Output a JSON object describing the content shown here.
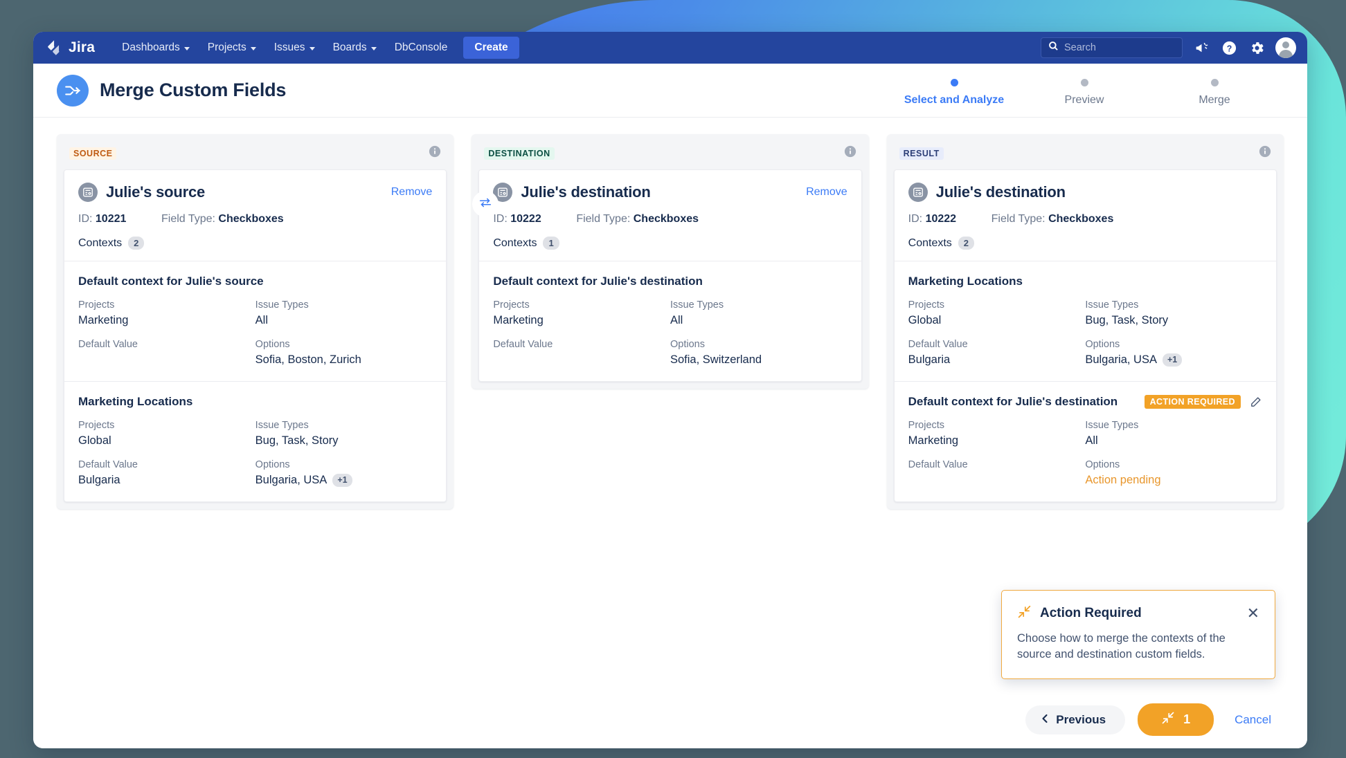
{
  "topnav": {
    "brand": "Jira",
    "items": [
      {
        "label": "Dashboards",
        "has_caret": true
      },
      {
        "label": "Projects",
        "has_caret": true
      },
      {
        "label": "Issues",
        "has_caret": true
      },
      {
        "label": "Boards",
        "has_caret": true
      },
      {
        "label": "DbConsole",
        "has_caret": false
      }
    ],
    "create_label": "Create",
    "search": {
      "value": "",
      "placeholder": "Search"
    },
    "icons": [
      "megaphone-icon",
      "help-icon",
      "settings-icon",
      "avatar"
    ],
    "bg_color": "#24459e",
    "create_color": "#3b63d8"
  },
  "header": {
    "title": "Merge Custom Fields",
    "icon": "merge-arrows-icon",
    "icon_color": "#4a90f0",
    "steps": [
      {
        "label": "Select and Analyze",
        "active": true
      },
      {
        "label": "Preview",
        "active": false
      },
      {
        "label": "Merge",
        "active": false
      }
    ],
    "active_color": "#3b7bf6",
    "inactive_color": "#6b778c"
  },
  "panels": {
    "source": {
      "tag": "SOURCE",
      "field_name": "Julie's source",
      "remove_label": "Remove",
      "id_label": "ID:",
      "id_value": "10221",
      "field_type_label": "Field Type:",
      "field_type_value": "Checkboxes",
      "contexts_label": "Contexts",
      "contexts_count": "2",
      "contexts": [
        {
          "title": "Default context for Julie's source",
          "projects_label": "Projects",
          "projects_value": "Marketing",
          "issue_types_label": "Issue Types",
          "issue_types_value": "All",
          "default_value_label": "Default Value",
          "default_value": "",
          "options_label": "Options",
          "options_value": "Sofia, Boston, Zurich",
          "options_extra": ""
        },
        {
          "title": "Marketing Locations",
          "projects_label": "Projects",
          "projects_value": "Global",
          "issue_types_label": "Issue Types",
          "issue_types_value": "Bug, Task, Story",
          "default_value_label": "Default Value",
          "default_value": "Bulgaria",
          "options_label": "Options",
          "options_value": "Bulgaria, USA",
          "options_extra": "+1"
        }
      ]
    },
    "destination": {
      "tag": "DESTINATION",
      "field_name": "Julie's destination",
      "remove_label": "Remove",
      "id_label": "ID:",
      "id_value": "10222",
      "field_type_label": "Field Type:",
      "field_type_value": "Checkboxes",
      "contexts_label": "Contexts",
      "contexts_count": "1",
      "contexts": [
        {
          "title": "Default context for Julie's destination",
          "projects_label": "Projects",
          "projects_value": "Marketing",
          "issue_types_label": "Issue Types",
          "issue_types_value": "All",
          "default_value_label": "Default Value",
          "default_value": "",
          "options_label": "Options",
          "options_value": "Sofia, Switzerland",
          "options_extra": ""
        }
      ]
    },
    "result": {
      "tag": "RESULT",
      "field_name": "Julie's destination",
      "id_label": "ID:",
      "id_value": "10222",
      "field_type_label": "Field Type:",
      "field_type_value": "Checkboxes",
      "contexts_label": "Contexts",
      "contexts_count": "2",
      "contexts": [
        {
          "title": "Marketing Locations",
          "badge": "",
          "projects_label": "Projects",
          "projects_value": "Global",
          "issue_types_label": "Issue Types",
          "issue_types_value": "Bug, Task, Story",
          "default_value_label": "Default Value",
          "default_value": "Bulgaria",
          "options_label": "Options",
          "options_value": "Bulgaria, USA",
          "options_extra": "+1",
          "options_pending": false
        },
        {
          "title": "Default context for Julie's destination",
          "badge": "ACTION REQUIRED",
          "projects_label": "Projects",
          "projects_value": "Marketing",
          "issue_types_label": "Issue Types",
          "issue_types_value": "All",
          "default_value_label": "Default Value",
          "default_value": "",
          "options_label": "Options",
          "options_value": "Action pending",
          "options_extra": "",
          "options_pending": true
        }
      ]
    }
  },
  "swap_icon": "swap-horizontal-icon",
  "toast": {
    "title": "Action Required",
    "icon": "merge-in-icon",
    "body": "Choose how to merge the contexts of the source and destination custom fields.",
    "close_icon": "close-icon",
    "border_color": "#f0a93f"
  },
  "footer": {
    "previous_label": "Previous",
    "merge_count": "1",
    "merge_icon": "merge-in-icon",
    "cancel_label": "Cancel",
    "merge_color": "#f2a227"
  },
  "colors": {
    "action_orange": "#f2a227",
    "link_blue": "#3b7bf6",
    "text_dark": "#172b4d",
    "text_muted": "#6b778c"
  }
}
